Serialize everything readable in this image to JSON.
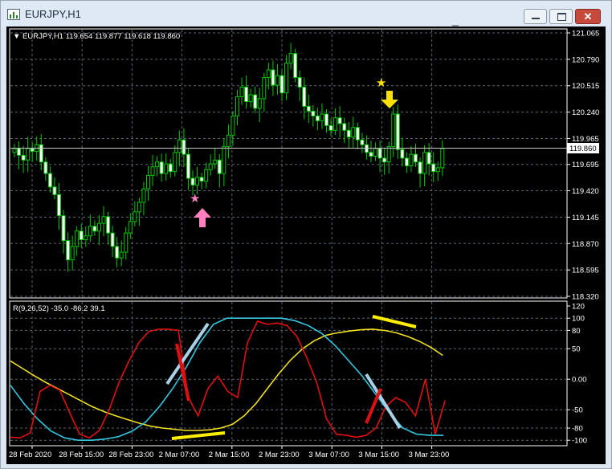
{
  "window": {
    "title": "EURJPY,H1",
    "buttons": {
      "minimize": "minimize",
      "maximize": "maximize",
      "close": "✕"
    }
  },
  "price_chart": {
    "header": "▼ EURJPY,H1  119.654 119.877 119.618 119.860",
    "price_axis": [
      "121.065",
      "120.790",
      "120.515",
      "120.240",
      "119.965",
      "119.695",
      "119.420",
      "119.145",
      "118.870",
      "118.595",
      "118.320"
    ],
    "current_price": "119.860",
    "colors": {
      "background": "#000000",
      "candle": "#00c800",
      "grid": "#5a6470",
      "axis_text": "#ffffff",
      "price_tag": "#ffffff"
    },
    "markers": [
      {
        "name": "pink-star",
        "glyph": "★",
        "color": "#ff7fc0"
      },
      {
        "name": "pink-up-arrow",
        "color": "#ff7fc0"
      },
      {
        "name": "yellow-star",
        "glyph": "★",
        "color": "#ffe000"
      },
      {
        "name": "yellow-down-arrow",
        "color": "#ffe000"
      }
    ]
  },
  "indicator": {
    "header": "R(9,26,52) -35.0 -86.2 39.1",
    "levels": [
      "120",
      "100",
      "80",
      "50",
      "0.00",
      "-50",
      "-80",
      "-100"
    ],
    "colors": {
      "fast": "#e01010",
      "mid": "#33c8e0",
      "slow": "#f0e020",
      "annot_yellow": "#ffee00",
      "annot_red": "#e01010",
      "annot_blue": "#a8d0e6"
    }
  },
  "time_axis": [
    "28 Feb 2020",
    "28 Feb 15:00",
    "28 Feb 23:00",
    "2 Mar 07:00",
    "2 Mar 15:00",
    "2 Mar 23:00",
    "3 Mar 07:00",
    "3 Mar 15:00",
    "3 Mar 23:00"
  ],
  "chart_data": [
    {
      "type": "candlestick",
      "title": "EURJPY,H1",
      "ylim": [
        118.32,
        121.065
      ],
      "ohlc_last": {
        "open": 119.654,
        "high": 119.877,
        "low": 119.618,
        "close": 119.86
      },
      "close_series": [
        119.86,
        119.79,
        119.74,
        119.86,
        119.83,
        119.9,
        119.72,
        119.6,
        119.46,
        119.38,
        119.16,
        118.9,
        118.7,
        118.84,
        119.0,
        118.91,
        118.95,
        119.05,
        119.0,
        119.08,
        119.15,
        118.98,
        118.84,
        118.72,
        118.78,
        118.98,
        119.1,
        119.2,
        119.3,
        119.44,
        119.58,
        119.67,
        119.72,
        119.6,
        119.7,
        119.62,
        119.82,
        119.95,
        119.8,
        119.55,
        119.48,
        119.56,
        119.52,
        119.64,
        119.7,
        119.74,
        119.6,
        119.88,
        120.0,
        120.2,
        120.4,
        120.5,
        120.35,
        120.42,
        120.28,
        120.38,
        120.6,
        120.68,
        120.52,
        120.62,
        120.44,
        120.75,
        120.85,
        120.6,
        120.5,
        120.3,
        120.25,
        120.2,
        120.15,
        120.22,
        120.1,
        120.05,
        120.18,
        120.12,
        120.05,
        119.98,
        120.08,
        119.95,
        119.9,
        119.82,
        119.78,
        119.86,
        119.76,
        119.72,
        119.88,
        120.22,
        119.85,
        119.76,
        119.68,
        119.8,
        119.72,
        119.6,
        119.82,
        119.7,
        119.62,
        119.66,
        119.86
      ],
      "annotations": [
        {
          "label": "★",
          "color": "pink",
          "near_price": 119.35
        },
        {
          "label": "up arrow",
          "color": "pink",
          "near_price": 119.12
        },
        {
          "label": "★",
          "color": "yellow",
          "near_price": 120.55
        },
        {
          "label": "down arrow",
          "color": "yellow",
          "near_price": 120.35
        }
      ]
    },
    {
      "type": "line",
      "title": "R(9,26,52)",
      "ylim": [
        -105,
        120
      ],
      "series": [
        {
          "name": "R(9)",
          "last": -35.0
        },
        {
          "name": "R(26)",
          "last": -86.2
        },
        {
          "name": "R(52)",
          "last": 39.1
        }
      ],
      "levels": [
        120,
        100,
        80,
        50,
        0,
        -50,
        -80,
        -100
      ]
    }
  ]
}
